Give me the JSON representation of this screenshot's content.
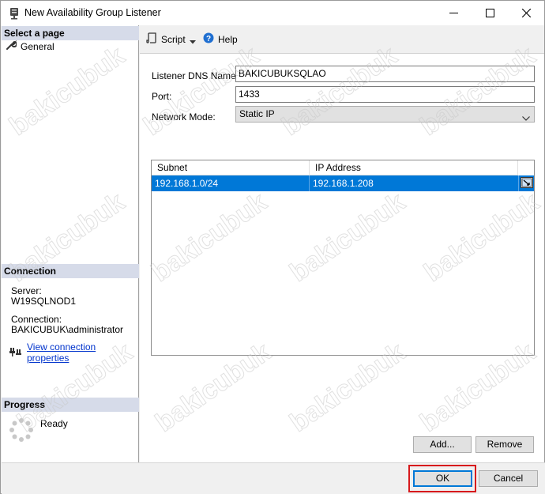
{
  "window": {
    "title": "New Availability Group Listener",
    "icon": "server-listener-icon",
    "controls": {
      "minimize": "—",
      "maximize": "☐",
      "close": "✕"
    }
  },
  "sidebar": {
    "select_page_header": "Select a page",
    "pages": [
      {
        "label": "General",
        "icon": "wrench-icon"
      }
    ],
    "connection_header": "Connection",
    "server_label": "Server:",
    "server_value": "W19SQLNOD1",
    "connection_label": "Connection:",
    "connection_value": "BAKICUBUK\\administrator",
    "view_properties_link": "View connection properties",
    "progress_header": "Progress",
    "progress_status": "Ready"
  },
  "toolbar": {
    "script_label": "Script",
    "help_label": "Help"
  },
  "form": {
    "dns_label": "Listener DNS Name:",
    "dns_value": "BAKICUBUKSQLAO",
    "port_label": "Port:",
    "port_value": "1433",
    "mode_label": "Network Mode:",
    "mode_value": "Static IP"
  },
  "grid": {
    "columns": [
      "Subnet",
      "IP Address"
    ],
    "rows": [
      {
        "subnet": "192.168.1.0/24",
        "ip": "192.168.1.208"
      }
    ]
  },
  "buttons": {
    "add": "Add...",
    "remove": "Remove",
    "ok": "OK",
    "cancel": "Cancel"
  },
  "watermark": "bakicubuk",
  "colors": {
    "selection": "#0078d7",
    "section_header": "#d6dbe9",
    "highlight": "#d7191c",
    "link": "#0033cc"
  }
}
